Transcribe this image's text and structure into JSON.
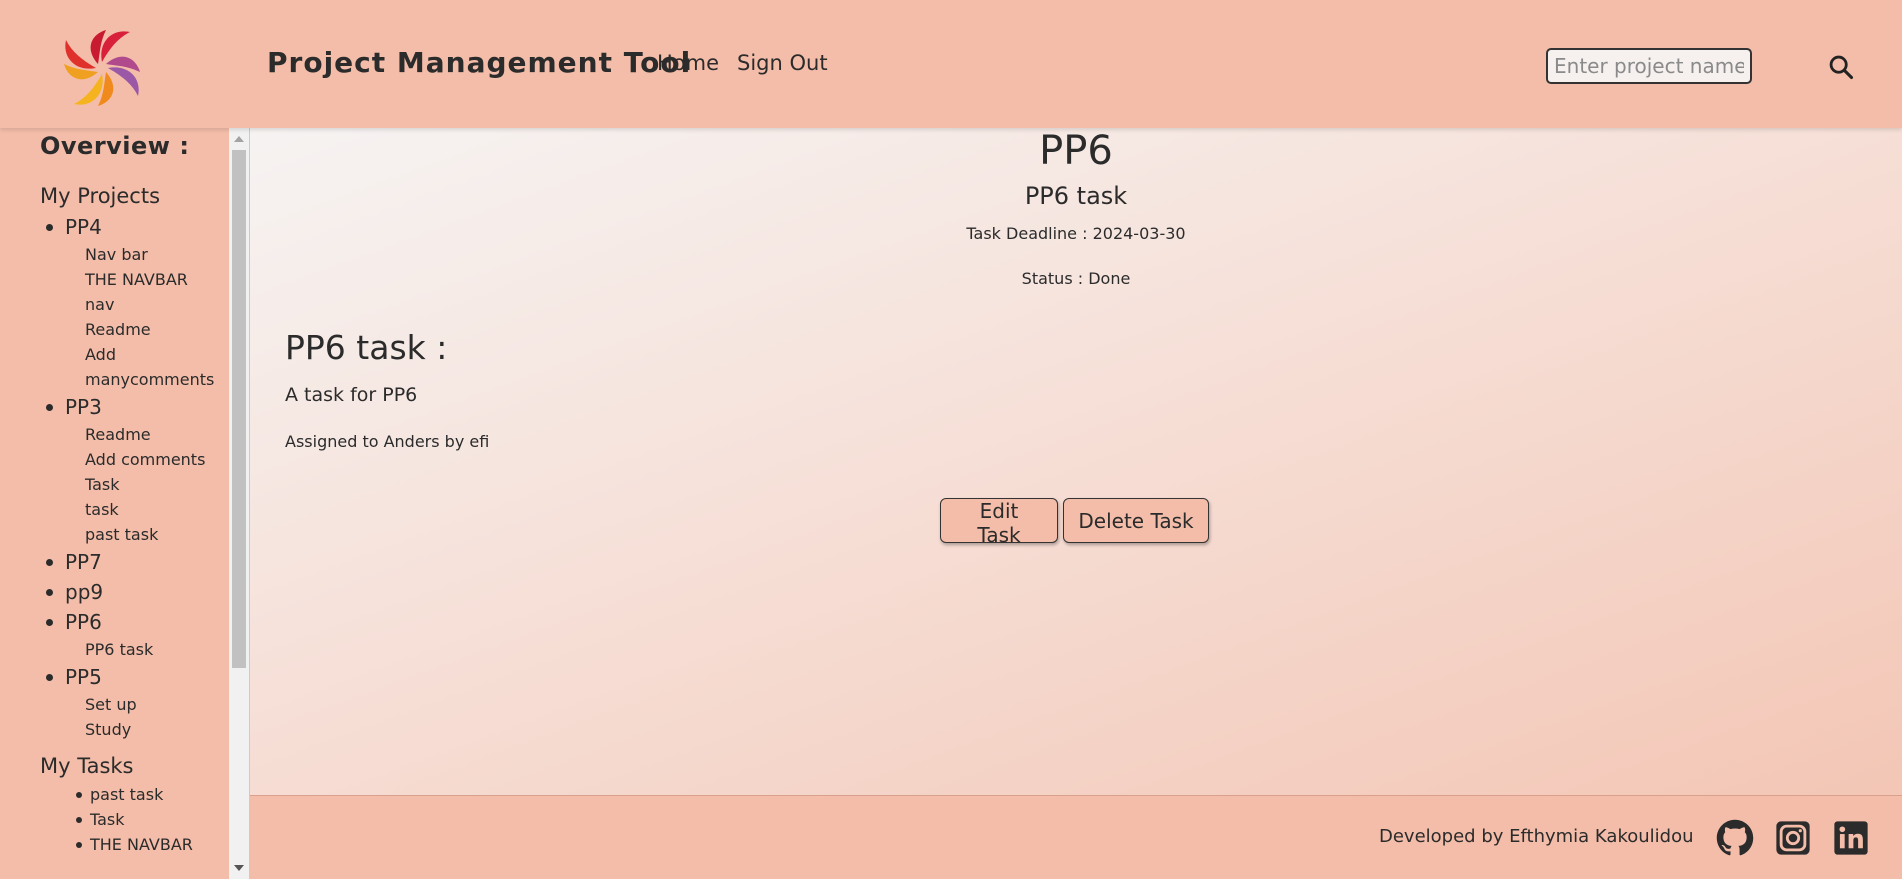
{
  "header": {
    "brand": "Project  Management  Tool",
    "nav": {
      "home": "Home",
      "sign_out": "Sign Out"
    },
    "search": {
      "placeholder": "Enter project name",
      "value": ""
    }
  },
  "sidebar": {
    "title": "Overview :",
    "my_projects_label": "My Projects",
    "projects": [
      {
        "name": "PP4",
        "tasks": [
          "Nav bar",
          "THE NAVBAR",
          "nav",
          "Readme",
          "Add manycomments"
        ]
      },
      {
        "name": "PP3",
        "tasks": [
          "Readme",
          "Add comments",
          "Task",
          "task",
          "past task"
        ]
      },
      {
        "name": "PP7",
        "tasks": []
      },
      {
        "name": "pp9",
        "tasks": []
      },
      {
        "name": "PP6",
        "tasks": [
          "PP6 task"
        ]
      },
      {
        "name": "PP5",
        "tasks": [
          "Set up",
          "Study"
        ]
      }
    ],
    "my_tasks_label": "My Tasks",
    "my_tasks": [
      "past task",
      "Task",
      "THE NAVBAR"
    ]
  },
  "main": {
    "project_title": "PP6",
    "task_title": "PP6 task",
    "deadline": "Task Deadline : 2024-03-30",
    "status": "Status : Done",
    "detail_heading": "PP6 task :",
    "description": "A task for PP6",
    "assigned": "Assigned to Anders by efi",
    "edit_label": "Edit Task",
    "delete_label": "Delete Task"
  },
  "footer": {
    "credit": "Developed by Efthymia Kakoulidou"
  },
  "colors": {
    "accent": "#f3bda9",
    "text": "#2b2b2b"
  }
}
